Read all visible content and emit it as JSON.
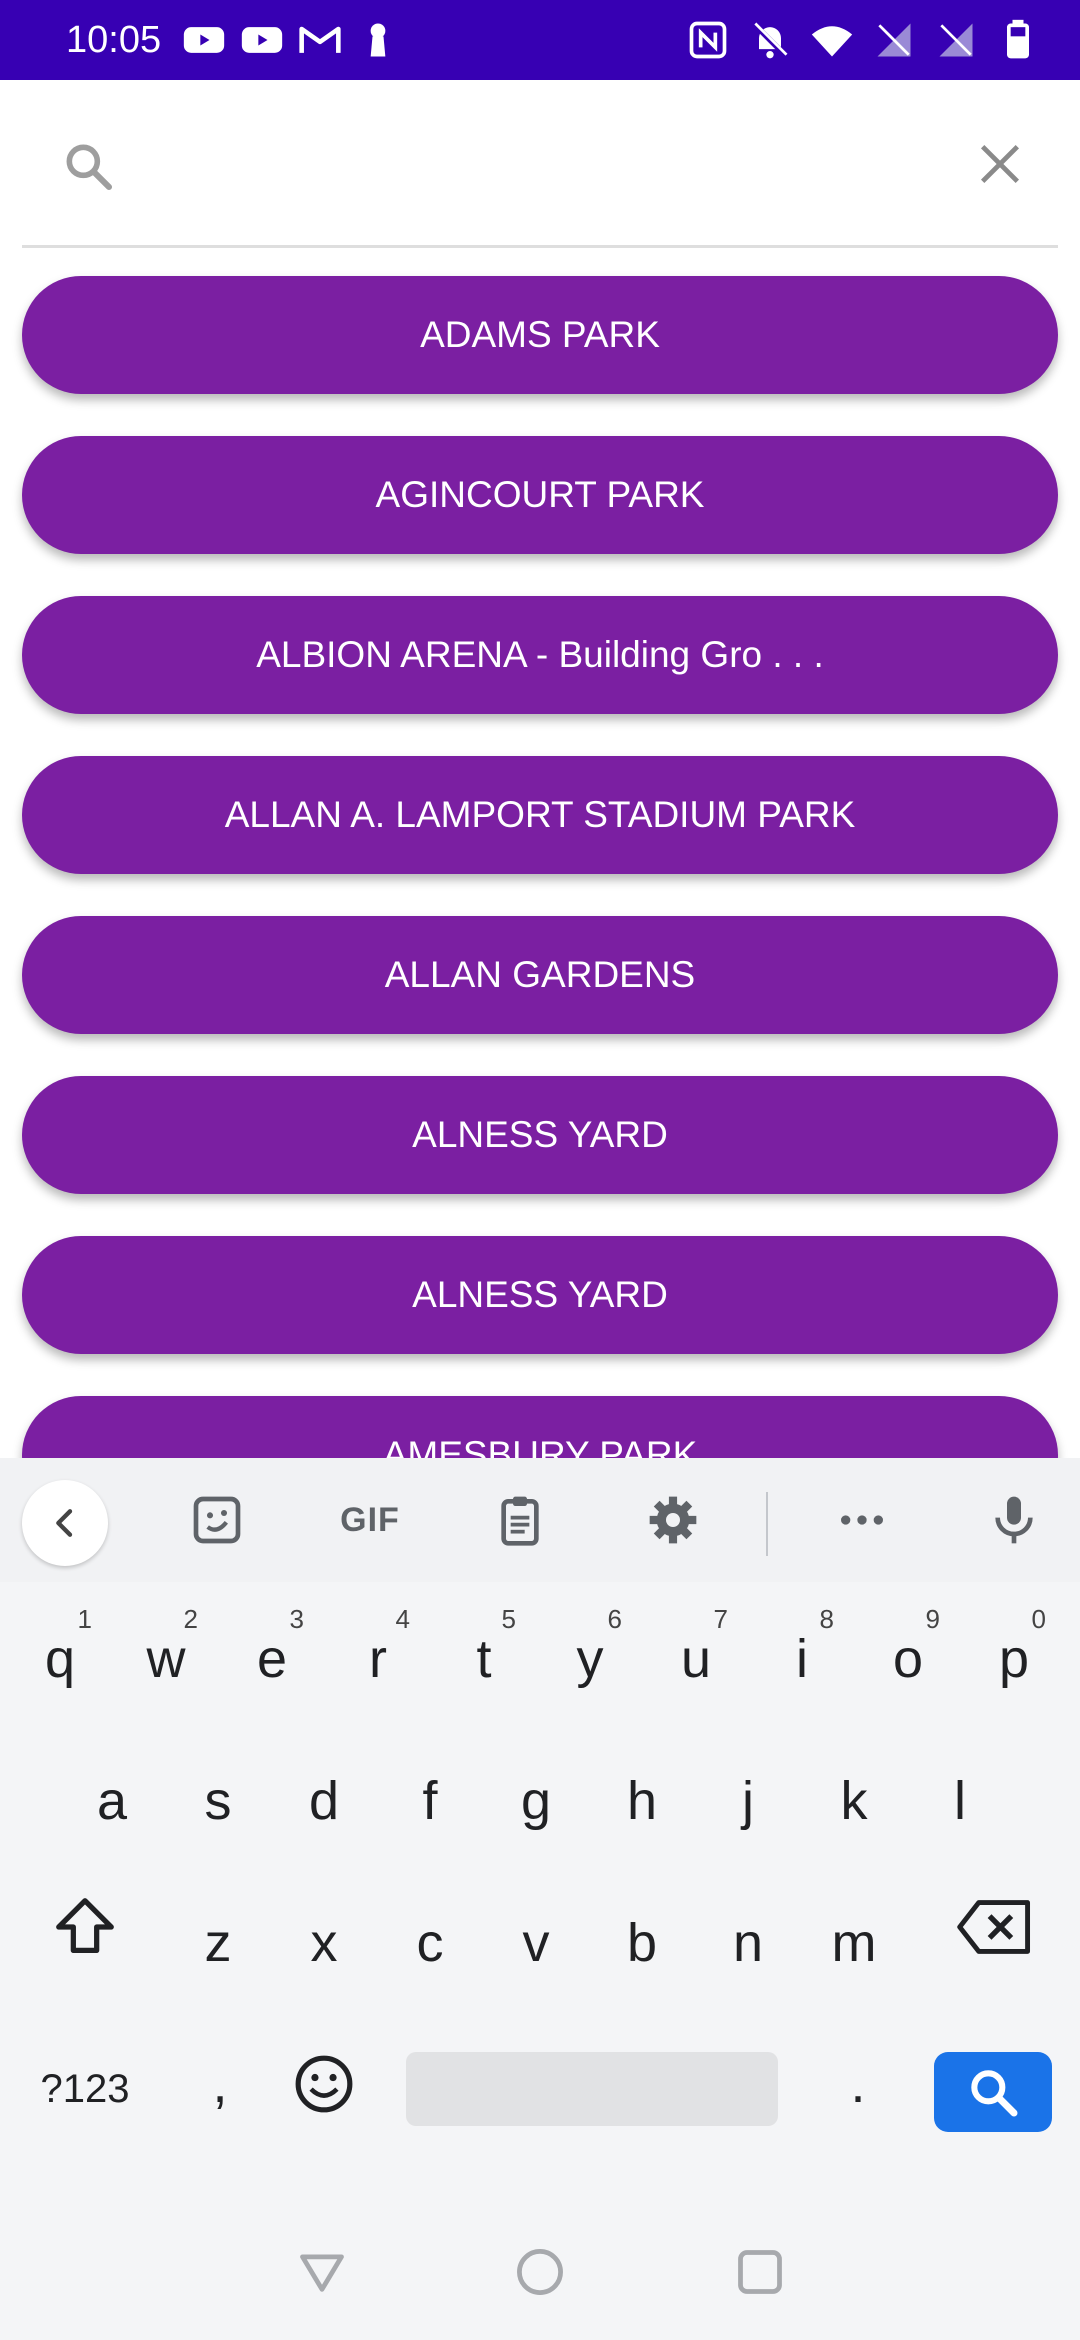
{
  "status_bar": {
    "time": "10:05",
    "left_icons": [
      "youtube-icon",
      "youtube-icon",
      "gmail-icon",
      "keyhole-icon"
    ],
    "right_icons": [
      "nfc-icon",
      "bell-off-icon",
      "wifi-icon",
      "no-signal-icon",
      "no-signal-icon",
      "battery-icon"
    ]
  },
  "search": {
    "value": "",
    "placeholder": ""
  },
  "parks": [
    "ADAMS PARK",
    "AGINCOURT PARK",
    "ALBION ARENA - Building Gro . . .",
    "ALLAN A. LAMPORT STADIUM PARK",
    "ALLAN GARDENS",
    "ALNESS YARD",
    "ALNESS YARD",
    "AMESBURY PARK"
  ],
  "keyboard": {
    "toolbar": [
      "back-chevron-icon",
      "sticker-icon",
      "GIF",
      "clipboard-icon",
      "gear-icon",
      "more-icon",
      "microphone-icon"
    ],
    "gif_label": "GIF",
    "row1": [
      "q",
      "w",
      "e",
      "r",
      "t",
      "y",
      "u",
      "i",
      "o",
      "p"
    ],
    "row1_hints": [
      "1",
      "2",
      "3",
      "4",
      "5",
      "6",
      "7",
      "8",
      "9",
      "0"
    ],
    "row2": [
      "a",
      "s",
      "d",
      "f",
      "g",
      "h",
      "j",
      "k",
      "l"
    ],
    "row3": [
      "z",
      "x",
      "c",
      "v",
      "b",
      "n",
      "m"
    ],
    "symbols_label": "?123",
    "comma": ",",
    "period": "."
  },
  "colors": {
    "status_bar": "#3700b3",
    "button": "#7b1fa2",
    "search_key": "#1a73e8"
  }
}
